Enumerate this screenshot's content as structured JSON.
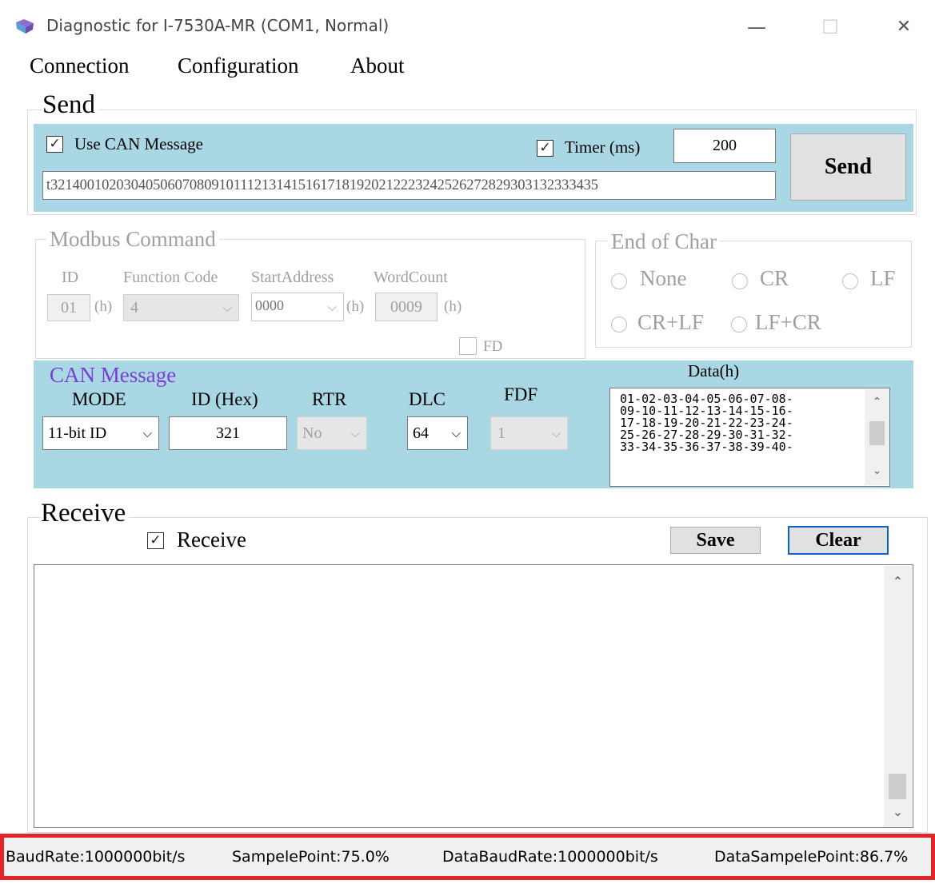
{
  "window": {
    "title": "Diagnostic for I-7530A-MR (COM1, Normal)",
    "icon": "app-icon",
    "minimize": "—",
    "maximize": "☐",
    "close": "✕"
  },
  "menu": [
    "Connection",
    "Configuration",
    "About"
  ],
  "send": {
    "title": "Send",
    "use_can_label": "Use CAN Message",
    "use_can_checked": true,
    "timer_label": "Timer (ms)",
    "timer_checked": true,
    "timer_value": "200",
    "message": "t321400102030405060708091011121314151617181920212223242526272829303132333435",
    "send_button": "Send"
  },
  "modbus": {
    "title": "Modbus Command",
    "id_label": "ID",
    "id_value": "01",
    "h1": "(h)",
    "function_label": "Function Code",
    "function_value": "4",
    "start_label": "StartAddress",
    "start_value": "0000",
    "h2": "(h)",
    "wordcount_label": "WordCount",
    "wordcount_value": "0009",
    "h3": "(h)",
    "fd_label": "FD"
  },
  "end_of_char": {
    "title": "End of Char",
    "options": [
      "None",
      "CR",
      "LF",
      "CR+LF",
      "LF+CR"
    ]
  },
  "can": {
    "title": "CAN Message",
    "mode_label": "MODE",
    "mode_value": "11-bit ID",
    "id_label": "ID (Hex)",
    "id_value": "321",
    "rtr_label": "RTR",
    "rtr_value": "No",
    "dlc_label": "DLC",
    "dlc_value": "64",
    "fdf_label": "FDF",
    "fdf_value": "1",
    "data_label": "Data(h)",
    "data_lines": [
      "01-02-03-04-05-06-07-08-",
      "09-10-11-12-13-14-15-16-",
      "17-18-19-20-21-22-23-24-",
      "25-26-27-28-29-30-31-32-",
      "33-34-35-36-37-38-39-40-"
    ]
  },
  "receive": {
    "title": "Receive",
    "checkbox_label": "Receive",
    "checked": true,
    "save_button": "Save",
    "clear_button": "Clear"
  },
  "status": {
    "baud": "BaudRate:1000000bit/s",
    "sample": "SampelePoint:75.0%",
    "data_baud": "DataBaudRate:1000000bit/s",
    "data_sample": "DataSampelePoint:86.7%"
  },
  "colors": {
    "panel_blue": "#a9d7e4",
    "can_title": "#7a3fd6",
    "status_border": "#e3242b",
    "focus_border": "#0a64c8"
  }
}
